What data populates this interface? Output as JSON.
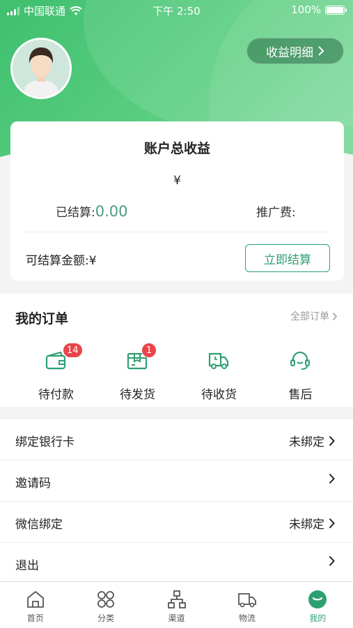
{
  "status_bar": {
    "carrier": "中国联通",
    "time": "下午 2:50",
    "battery": "100%"
  },
  "header": {
    "detail_button": "收益明细"
  },
  "income_card": {
    "title": "账户总收益",
    "total": "¥",
    "settled_label": "已结算:",
    "settled_value": "0.00",
    "promo_label": "推广费:",
    "available_label": "可结算金额:¥",
    "settle_button": "立即结算"
  },
  "orders": {
    "title": "我的订单",
    "all_link": "全部订单",
    "items": [
      {
        "label": "待付款",
        "badge": "14",
        "icon": "wallet-icon"
      },
      {
        "label": "待发货",
        "badge": "1",
        "icon": "package-icon"
      },
      {
        "label": "待收货",
        "icon": "delivery-truck-icon"
      },
      {
        "label": "售后",
        "icon": "headset-icon"
      }
    ]
  },
  "settings": [
    {
      "label": "绑定银行卡",
      "value": "未绑定"
    },
    {
      "label": "邀请码",
      "value": ""
    },
    {
      "label": "微信绑定",
      "value": "未绑定"
    },
    {
      "label": "退出",
      "value": ""
    }
  ],
  "tabbar": [
    {
      "label": "首页",
      "icon": "home-icon"
    },
    {
      "label": "分类",
      "icon": "category-icon"
    },
    {
      "label": "渠道",
      "icon": "channel-icon"
    },
    {
      "label": "物流",
      "icon": "logistics-icon"
    },
    {
      "label": "我的",
      "icon": "profile-icon",
      "active": true
    }
  ],
  "colors": {
    "brand": "#2e9f73",
    "header_gradient_start": "#3fbf6f",
    "badge": "#e8454a"
  }
}
